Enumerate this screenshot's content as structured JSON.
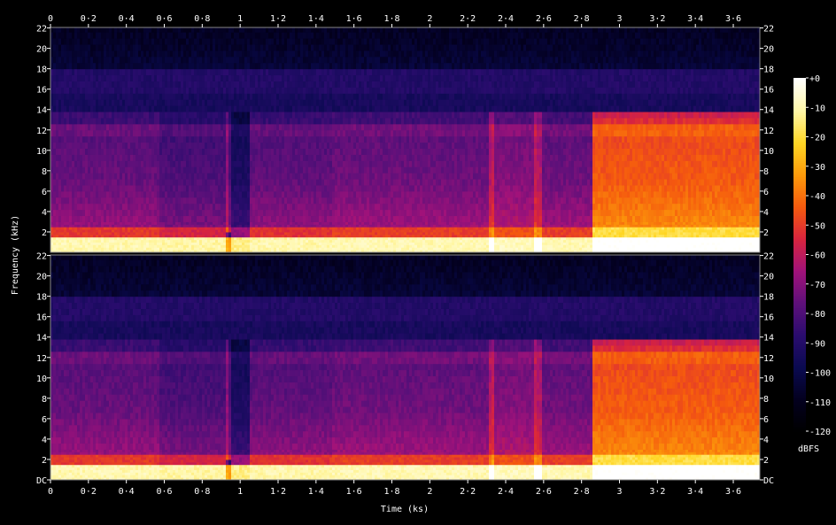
{
  "chart_data": {
    "type": "heatmap",
    "xlabel": "Time (ks)",
    "ylabel": "Frequency (kHz)",
    "colorbar_label": "dBFS",
    "xlim": [
      0,
      3.74
    ],
    "ylim": [
      0,
      22.05
    ],
    "x_ticks": [
      "0",
      "0·2",
      "0·4",
      "0·6",
      "0·8",
      "1",
      "1·2",
      "1·4",
      "1·6",
      "1·8",
      "2",
      "2·2",
      "2·4",
      "2·6",
      "2·8",
      "3",
      "3·2",
      "3·4",
      "3·6"
    ],
    "x_tick_values": [
      0,
      0.2,
      0.4,
      0.6,
      0.8,
      1.0,
      1.2,
      1.4,
      1.6,
      1.8,
      2.0,
      2.2,
      2.4,
      2.6,
      2.8,
      3.0,
      3.2,
      3.4,
      3.6
    ],
    "y_ticks_top": [
      "22",
      "20",
      "18",
      "16",
      "14",
      "12",
      "10",
      "8",
      "6",
      "4",
      "2"
    ],
    "y_ticks_bottom": [
      "22",
      "20",
      "18",
      "16",
      "14",
      "12",
      "10",
      "8",
      "6",
      "4",
      "2",
      "DC"
    ],
    "y_tick_values_top": [
      22,
      20,
      18,
      16,
      14,
      12,
      10,
      8,
      6,
      4,
      2
    ],
    "y_tick_values_bottom": [
      22,
      20,
      18,
      16,
      14,
      12,
      10,
      8,
      6,
      4,
      2,
      0
    ],
    "colorbar_ticks": [
      "+0",
      "-10",
      "-20",
      "-30",
      "-40",
      "-50",
      "-60",
      "-70",
      "-80",
      "-90",
      "-100",
      "-110",
      "-120"
    ],
    "colorbar_values": [
      0,
      -10,
      -20,
      -30,
      -40,
      -50,
      -60,
      -70,
      -80,
      -90,
      -100,
      -110,
      -120
    ],
    "colorbar_range": [
      -120,
      0
    ],
    "channels": [
      "top",
      "bottom"
    ],
    "colors": [
      "#000000",
      "#03001e",
      "#0a0a50",
      "#2a0c6e",
      "#5e107a",
      "#a0127a",
      "#d8243e",
      "#f55a0e",
      "#fc9a0a",
      "#ffd624",
      "#fff7a8",
      "#ffffff"
    ],
    "segments_ks": [
      {
        "x0": 0.0,
        "x1": 0.57,
        "level": 0.56
      },
      {
        "x0": 0.57,
        "x1": 0.93,
        "level": 0.52
      },
      {
        "x0": 0.93,
        "x1": 1.05,
        "level": 0.42
      },
      {
        "x0": 1.05,
        "x1": 1.48,
        "level": 0.55
      },
      {
        "x0": 1.48,
        "x1": 2.32,
        "level": 0.57
      },
      {
        "x0": 2.32,
        "x1": 2.55,
        "level": 0.6
      },
      {
        "x0": 2.55,
        "x1": 2.85,
        "level": 0.57
      },
      {
        "x0": 2.85,
        "x1": 3.74,
        "level": 0.78
      }
    ],
    "spikes_ks": [
      0.93,
      2.32,
      2.56
    ]
  }
}
